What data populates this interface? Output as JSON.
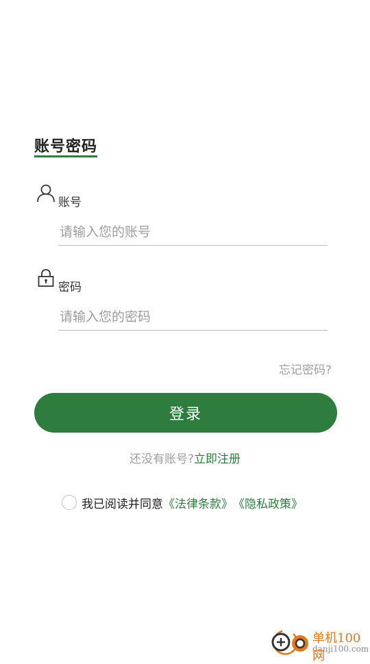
{
  "tab": {
    "title": "账号密码"
  },
  "account": {
    "label": "账号",
    "placeholder": "请输入您的账号",
    "icon": "user-icon"
  },
  "password": {
    "label": "密码",
    "placeholder": "请输入您的密码",
    "icon": "lock-icon"
  },
  "forgot_label": "忘记密码?",
  "login_label": "登录",
  "register": {
    "prompt": "还没有账号?",
    "link": "立即注册"
  },
  "agreement": {
    "text": "我已阅读并同意",
    "terms": "《法律条款》",
    "privacy": "《隐私政策》",
    "checked": false
  },
  "watermark": {
    "name": "单机100网",
    "url": "danji100.com"
  },
  "colors": {
    "accent": "#2e7d3e",
    "muted": "#9e9e9e"
  }
}
